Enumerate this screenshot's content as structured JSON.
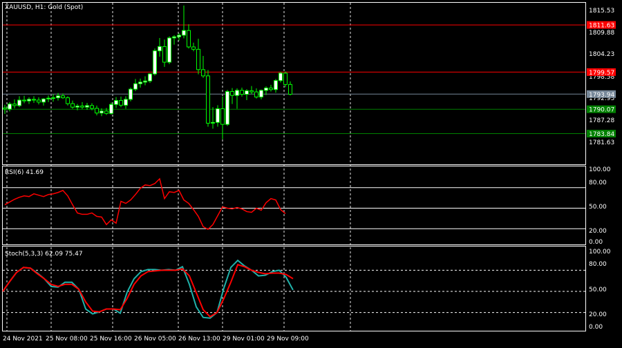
{
  "colors": {
    "background": "#000000",
    "foreground": "#ffffff",
    "candle_body": "#ffffff",
    "candle_bull": "#00ff00",
    "rsi_line": "#ff0000",
    "stoch_main": "#20b2aa",
    "stoch_signal": "#ff0000",
    "hline_red": "#ff0000",
    "hline_green": "#008000",
    "hline_grey": "#778899"
  },
  "price_panel": {
    "title": "XAUUSD, H1:  Gold (Spot)",
    "y_ticks": [
      "1815.53",
      "1809.88",
      "1804.23",
      "1798.58",
      "1792.93",
      "1787.28",
      "1781.63"
    ],
    "ylim": [
      1779.3,
      1817.2
    ],
    "hlines": [
      {
        "value": 1811.63,
        "label": "1811.63",
        "color": "red"
      },
      {
        "value": 1799.57,
        "label": "1799.57",
        "color": "red"
      },
      {
        "value": 1793.94,
        "label": "1793.94",
        "color": "grey"
      },
      {
        "value": 1790.07,
        "label": "1790.07",
        "color": "green"
      },
      {
        "value": 1783.84,
        "label": "1783.84",
        "color": "green"
      }
    ]
  },
  "rsi_panel": {
    "title": "RSI(6) 41.69",
    "y_ticks": [
      "100.00",
      "80.00",
      "50.00",
      "20.00",
      "0.00"
    ],
    "levels": [
      80,
      50,
      20
    ]
  },
  "stoch_panel": {
    "title": "Stoch(5,3,3) 62.09 75.47",
    "y_ticks": [
      "100.00",
      "80.00",
      "50.00",
      "20.00",
      "0.00"
    ],
    "levels": [
      80,
      50,
      20
    ]
  },
  "x_axis": {
    "labels": [
      "24 Nov 2021",
      "25 Nov 08:00",
      "25 Nov 16:00",
      "26 Nov 05:00",
      "26 Nov 13:00",
      "29 Nov 01:00",
      "29 Nov 09:00"
    ],
    "label_bars": [
      0,
      13,
      26,
      35,
      43,
      52,
      67
    ]
  },
  "chart_data": {
    "type": "candlestick",
    "title": "XAUUSD, H1:  Gold (Spot)",
    "ohlc": [
      [
        1790.4,
        1791.2,
        1788.9,
        1790.1
      ],
      [
        1790.1,
        1791.9,
        1789.5,
        1791.4
      ],
      [
        1791.4,
        1792.6,
        1790.3,
        1791.0
      ],
      [
        1791.0,
        1793.4,
        1790.6,
        1792.4
      ],
      [
        1792.4,
        1793.5,
        1791.6,
        1792.2
      ],
      [
        1792.2,
        1793.1,
        1791.4,
        1792.6
      ],
      [
        1792.6,
        1793.4,
        1791.7,
        1792.4
      ],
      [
        1792.4,
        1793.1,
        1791.3,
        1791.9
      ],
      [
        1791.9,
        1792.9,
        1791.0,
        1792.7
      ],
      [
        1792.7,
        1793.6,
        1791.9,
        1792.9
      ],
      [
        1792.9,
        1793.9,
        1792.0,
        1793.0
      ],
      [
        1793.0,
        1794.2,
        1792.3,
        1793.5
      ],
      [
        1793.5,
        1794.1,
        1792.7,
        1793.0
      ],
      [
        1793.0,
        1793.4,
        1791.0,
        1791.5
      ],
      [
        1791.5,
        1792.3,
        1790.2,
        1790.6
      ],
      [
        1790.6,
        1791.4,
        1789.8,
        1790.9
      ],
      [
        1790.9,
        1791.9,
        1790.1,
        1790.6
      ],
      [
        1790.6,
        1791.7,
        1789.9,
        1791.0
      ],
      [
        1791.0,
        1791.6,
        1789.8,
        1790.3
      ],
      [
        1790.3,
        1791.0,
        1788.5,
        1789.1
      ],
      [
        1789.1,
        1790.3,
        1788.3,
        1789.6
      ],
      [
        1789.6,
        1790.4,
        1788.6,
        1789.0
      ],
      [
        1789.0,
        1791.8,
        1788.7,
        1791.3
      ],
      [
        1791.3,
        1793.2,
        1790.4,
        1792.3
      ],
      [
        1792.3,
        1793.3,
        1790.6,
        1791.1
      ],
      [
        1791.1,
        1793.4,
        1790.2,
        1792.6
      ],
      [
        1792.6,
        1795.6,
        1792.1,
        1795.2
      ],
      [
        1795.2,
        1797.8,
        1794.7,
        1796.6
      ],
      [
        1796.6,
        1797.9,
        1795.6,
        1797.0
      ],
      [
        1797.0,
        1798.5,
        1796.2,
        1797.3
      ],
      [
        1797.3,
        1799.3,
        1796.8,
        1799.1
      ],
      [
        1799.1,
        1805.6,
        1798.7,
        1805.0
      ],
      [
        1805.0,
        1808.3,
        1803.5,
        1806.1
      ],
      [
        1806.1,
        1807.9,
        1800.9,
        1802.1
      ],
      [
        1802.1,
        1808.7,
        1801.6,
        1808.3
      ],
      [
        1808.3,
        1809.0,
        1806.6,
        1808.6
      ],
      [
        1808.6,
        1809.5,
        1807.6,
        1809.0
      ],
      [
        1809.0,
        1816.6,
        1808.2,
        1810.2
      ],
      [
        1810.2,
        1811.8,
        1805.6,
        1806.0
      ],
      [
        1806.0,
        1807.1,
        1804.9,
        1805.4
      ],
      [
        1805.4,
        1808.1,
        1799.0,
        1800.2
      ],
      [
        1800.2,
        1803.7,
        1798.1,
        1798.6
      ],
      [
        1798.6,
        1800.1,
        1785.6,
        1786.5
      ],
      [
        1786.5,
        1790.6,
        1785.1,
        1786.7
      ],
      [
        1786.7,
        1791.1,
        1785.6,
        1790.2
      ],
      [
        1790.2,
        1793.3,
        1782.4,
        1786.2
      ],
      [
        1786.2,
        1795.0,
        1785.8,
        1794.6
      ],
      [
        1794.6,
        1795.5,
        1791.4,
        1793.6
      ],
      [
        1793.6,
        1795.4,
        1790.2,
        1794.9
      ],
      [
        1794.9,
        1795.6,
        1793.3,
        1793.9
      ],
      [
        1793.9,
        1795.2,
        1792.4,
        1794.8
      ],
      [
        1794.8,
        1796.0,
        1793.9,
        1794.5
      ],
      [
        1794.5,
        1795.4,
        1792.8,
        1793.2
      ],
      [
        1793.2,
        1795.1,
        1792.6,
        1794.9
      ],
      [
        1794.9,
        1795.9,
        1793.7,
        1795.5
      ],
      [
        1795.5,
        1796.3,
        1794.6,
        1795.1
      ],
      [
        1795.1,
        1797.8,
        1794.3,
        1797.4
      ],
      [
        1797.4,
        1799.6,
        1796.9,
        1799.3
      ],
      [
        1799.3,
        1799.7,
        1795.7,
        1796.4
      ],
      [
        1796.4,
        1797.2,
        1793.6,
        1793.9
      ]
    ],
    "rsi": [
      55,
      59,
      63,
      66,
      68,
      67,
      71,
      69,
      67,
      70,
      71,
      73,
      76,
      68,
      55,
      43,
      41,
      41,
      43,
      38,
      37,
      26,
      33,
      28,
      60,
      57,
      62,
      70,
      79,
      84,
      83,
      86,
      93,
      64,
      74,
      73,
      76,
      62,
      57,
      48,
      38,
      23,
      19,
      26,
      39,
      52,
      50,
      49,
      51,
      49,
      45,
      44,
      50,
      47,
      58,
      64,
      62,
      48,
      42
    ],
    "stoch_main": [
      50,
      64,
      77,
      84,
      83,
      76,
      68,
      57,
      56,
      63,
      63,
      53,
      25,
      18,
      21,
      25,
      25,
      19,
      49,
      68,
      78,
      81,
      81,
      80,
      81,
      80,
      85,
      60,
      28,
      13,
      12,
      20,
      55,
      84,
      94,
      86,
      80,
      72,
      73,
      78,
      80,
      70,
      52
    ],
    "stoch_signal": [
      50,
      64,
      77,
      84,
      83,
      75,
      68,
      60,
      57,
      60,
      60,
      53,
      35,
      22,
      21,
      25,
      25,
      24,
      40,
      60,
      72,
      78,
      79,
      80,
      80,
      80,
      82,
      72,
      48,
      24,
      14,
      20,
      40,
      63,
      88,
      85,
      80,
      77,
      75,
      76,
      76,
      74,
      68
    ]
  }
}
